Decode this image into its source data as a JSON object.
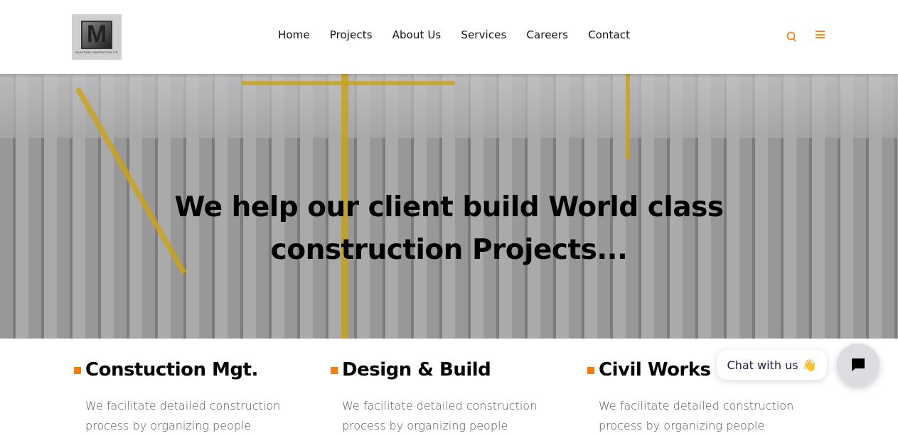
{
  "header": {
    "logo": {
      "letter": "M",
      "caption": "MILESTONE CONSTRUCTION LTD"
    },
    "nav": [
      "Home",
      "Projects",
      "About Us",
      "Services",
      "Careers",
      "Contact"
    ],
    "accent_color": "#f0891a"
  },
  "hero": {
    "headline_line1": "We help our client build World class",
    "headline_line2": "construction Projects..."
  },
  "services": [
    {
      "title": "Constuction Mgt.",
      "text": "We facilitate detailed construction process by organizing people"
    },
    {
      "title": "Design & Build",
      "text": "We facilitate detailed construction process by organizing people"
    },
    {
      "title": "Civil Works",
      "text": "We facilitate detailed construction process by organizing people"
    }
  ],
  "chat": {
    "label": "Chat with us",
    "emoji": "👋"
  }
}
